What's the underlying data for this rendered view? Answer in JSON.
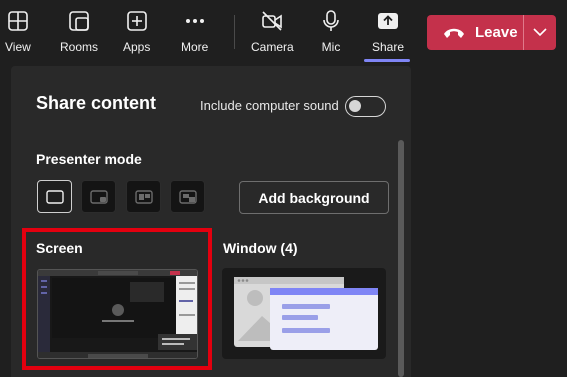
{
  "toolbar": {
    "view": "View",
    "rooms": "Rooms",
    "apps": "Apps",
    "more": "More",
    "camera": "Camera",
    "mic": "Mic",
    "share": "Share",
    "leave": "Leave"
  },
  "panel": {
    "title": "Share content",
    "include_sound": "Include computer sound",
    "include_sound_on": false,
    "presenter_mode": "Presenter mode",
    "add_background": "Add background",
    "screen_label": "Screen",
    "window_label": "Window (4)"
  },
  "colors": {
    "leave_red": "#c4314b",
    "share_accent": "#7f85f5",
    "highlight_red": "#e3000f",
    "window_purple": "#7f85f5"
  }
}
